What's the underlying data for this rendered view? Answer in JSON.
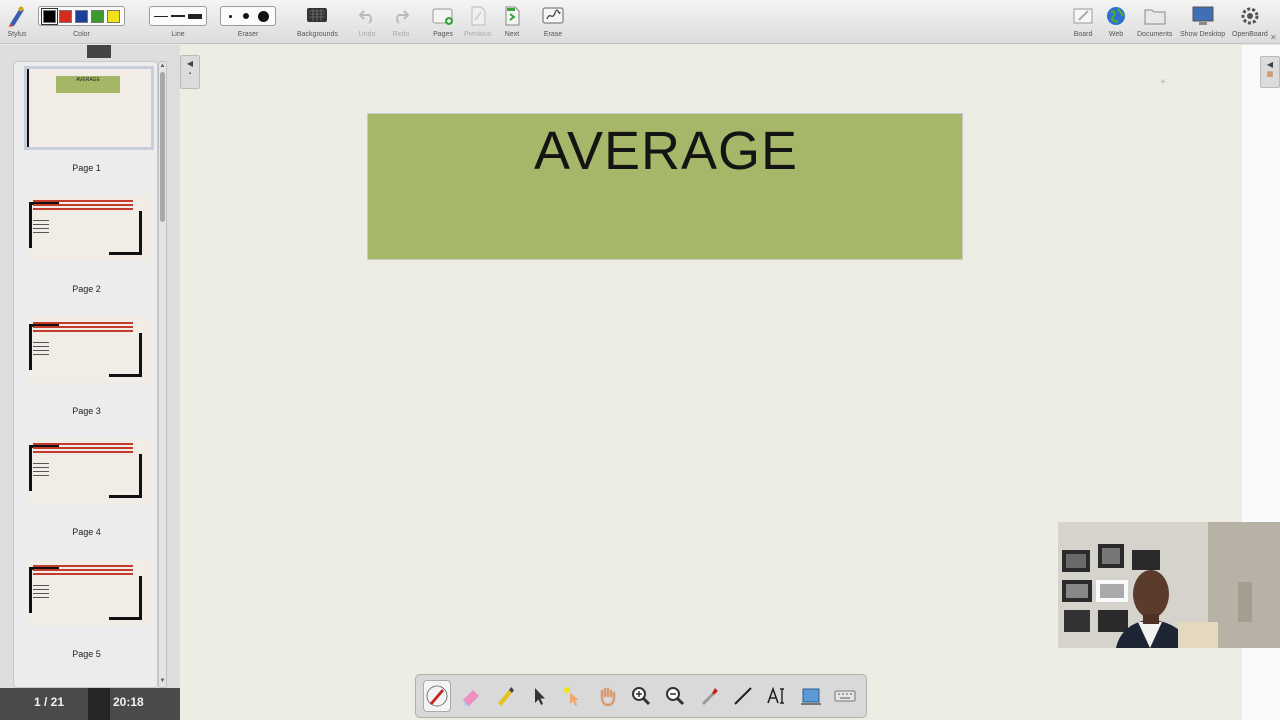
{
  "toolbar": {
    "stylus_label": "Stylus",
    "color_label": "Color",
    "colors": [
      "#000000",
      "#d42a20",
      "#1c3f9a",
      "#3a9a2c",
      "#f2e21a"
    ],
    "line_label": "Line",
    "eraser_label": "Eraser",
    "backgrounds_label": "Backgrounds",
    "undo_label": "Undo",
    "redo_label": "Redo",
    "pages_label": "Pages",
    "previous_label": "Previous",
    "next_label": "Next",
    "erase_label": "Erase",
    "board_label": "Board",
    "web_label": "Web",
    "documents_label": "Documents",
    "show_desktop_label": "Show Desktop",
    "openboard_label": "OpenBoard"
  },
  "thumbnails": {
    "pages": [
      {
        "label": "Page 1",
        "title": "AVERAGE"
      },
      {
        "label": "Page 2"
      },
      {
        "label": "Page 3"
      },
      {
        "label": "Page 4"
      },
      {
        "label": "Page 5"
      }
    ]
  },
  "status": {
    "page_count": "1 / 21",
    "clock": "20:18"
  },
  "board": {
    "title": "AVERAGE",
    "banner_color": "#a6b769"
  },
  "palette": {
    "tools": [
      "pen-icon",
      "eraser-icon",
      "highlighter-icon",
      "pointer-icon",
      "laser-pointer-icon",
      "hand-icon",
      "zoom-in-icon",
      "zoom-out-icon",
      "pipette-icon",
      "line-icon",
      "text-icon",
      "capture-icon",
      "keyboard-icon"
    ]
  }
}
